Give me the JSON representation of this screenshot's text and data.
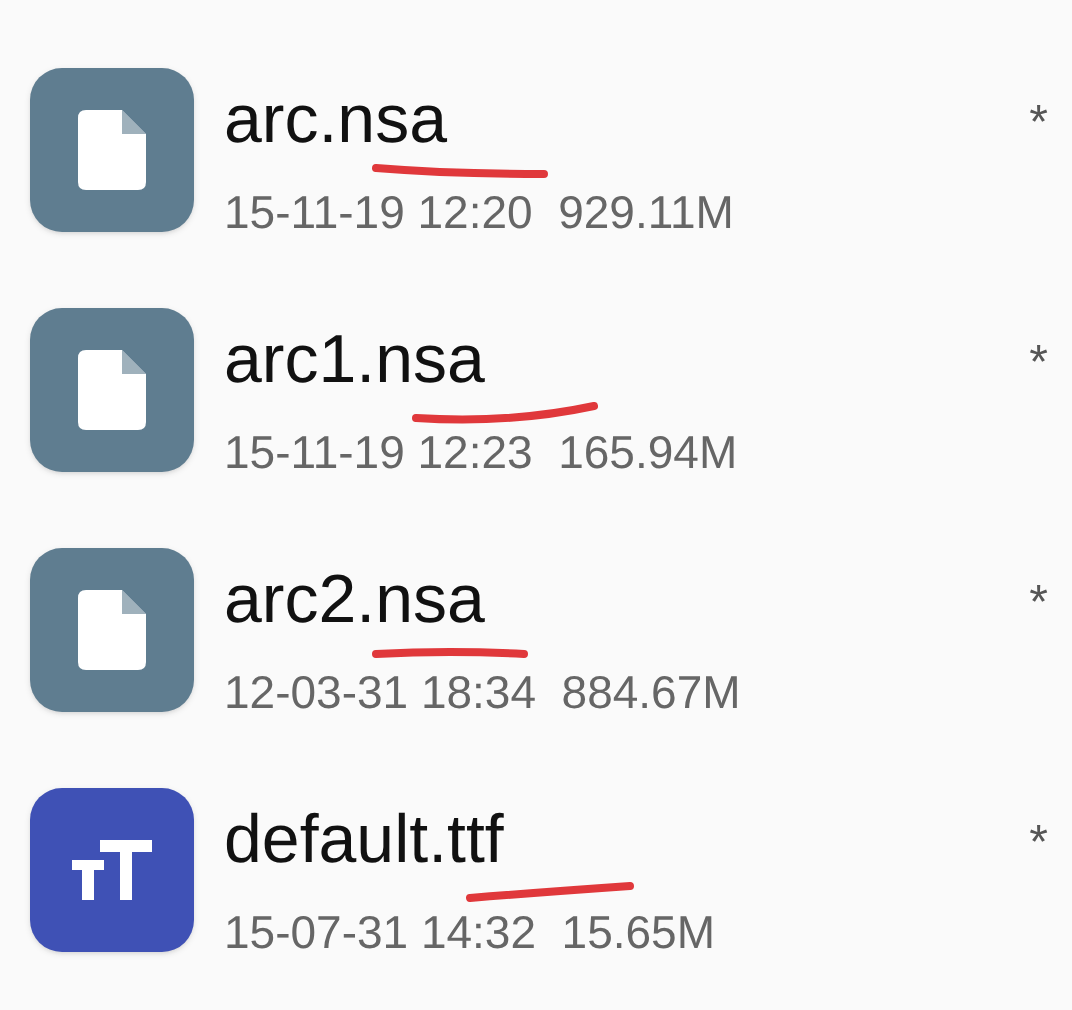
{
  "files": [
    {
      "kind": "file",
      "name": "arc.nsa",
      "date": "15-11-19 12:20",
      "size": "929.11M",
      "marker": "*"
    },
    {
      "kind": "file",
      "name": "arc1.nsa",
      "date": "15-11-19 12:23",
      "size": "165.94M",
      "marker": "*"
    },
    {
      "kind": "file",
      "name": "arc2.nsa",
      "date": "12-03-31 18:34",
      "size": "884.67M",
      "marker": "*"
    },
    {
      "kind": "font",
      "name": "default.ttf",
      "date": "15-07-31 14:32",
      "size": "15.65M",
      "marker": "*"
    }
  ]
}
